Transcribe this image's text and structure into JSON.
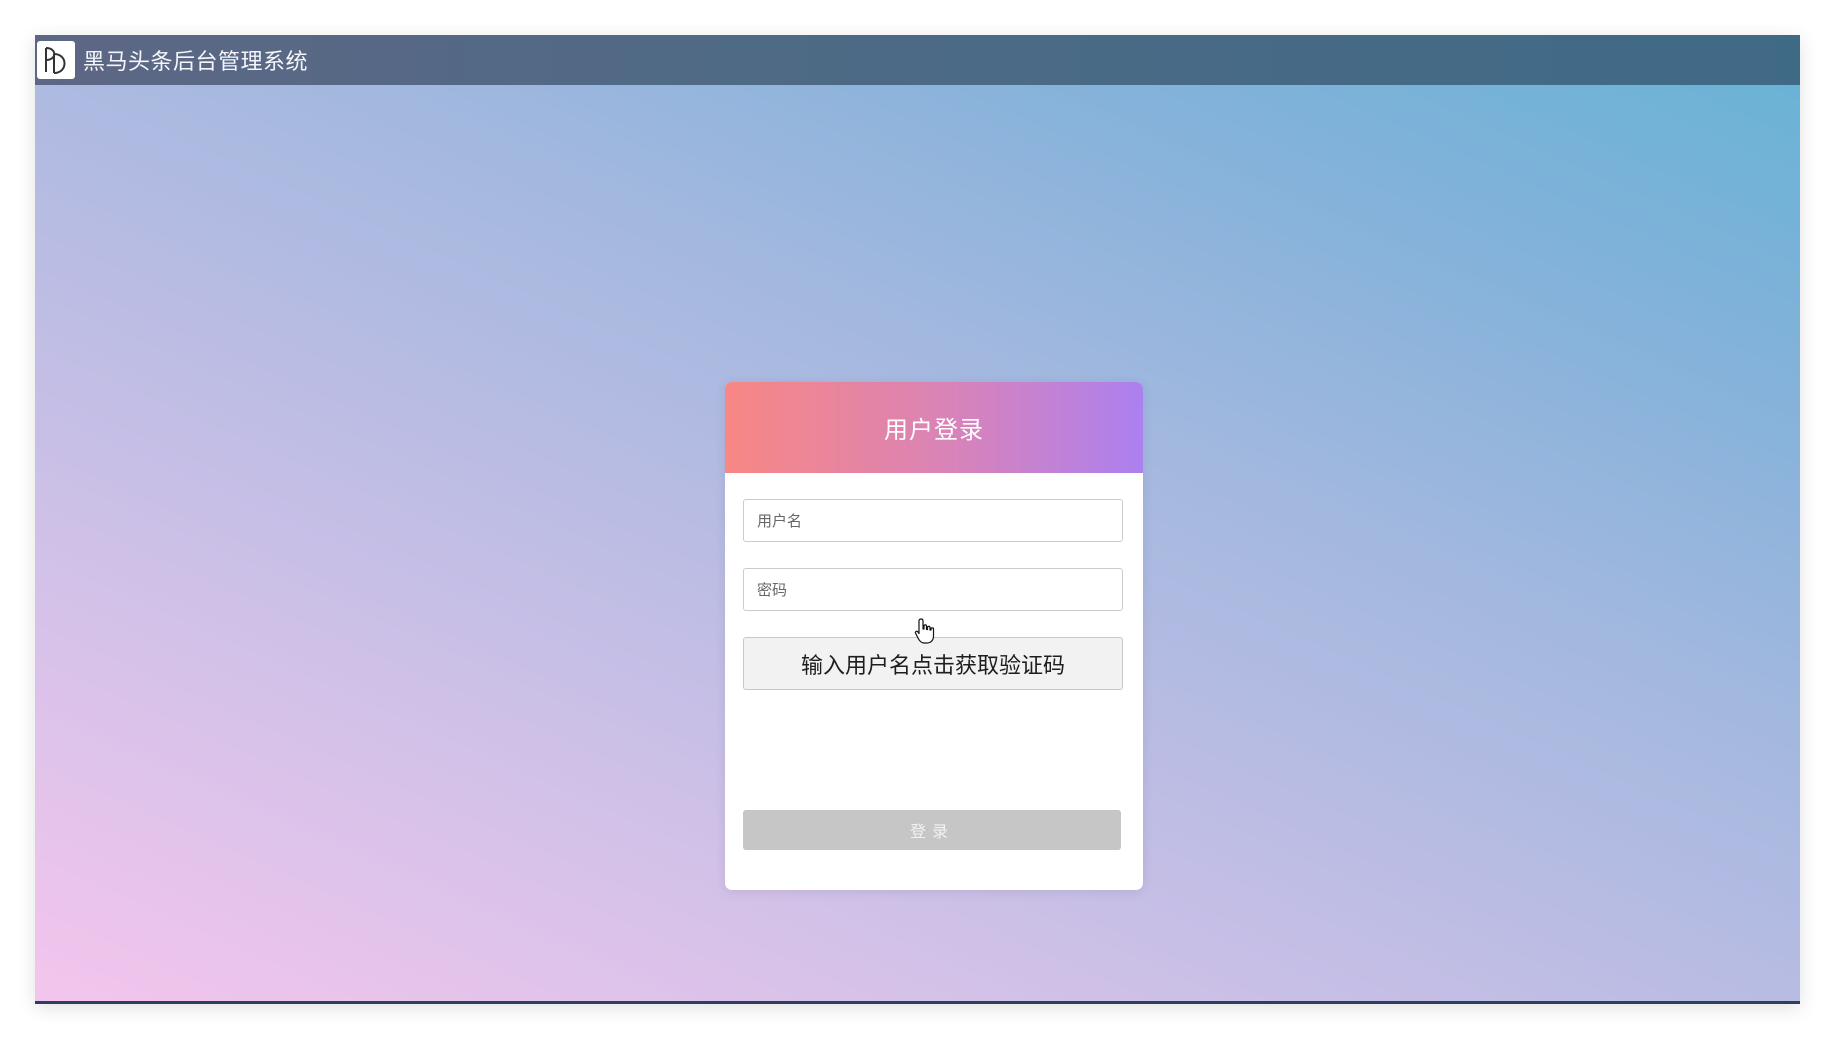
{
  "app": {
    "title": "黑马头条后台管理系统",
    "logo_icon": "pd-logo-icon"
  },
  "login": {
    "heading": "用户登录",
    "username_placeholder": "用户名",
    "password_placeholder": "密码",
    "get_code_label": "输入用户名点击获取验证码",
    "submit_label": "登录"
  },
  "colors": {
    "header_gradient_start": "#f88784",
    "header_gradient_end": "#ac80f0",
    "topbar": "#4d6a85",
    "submit_disabled": "#c6c6c6"
  }
}
